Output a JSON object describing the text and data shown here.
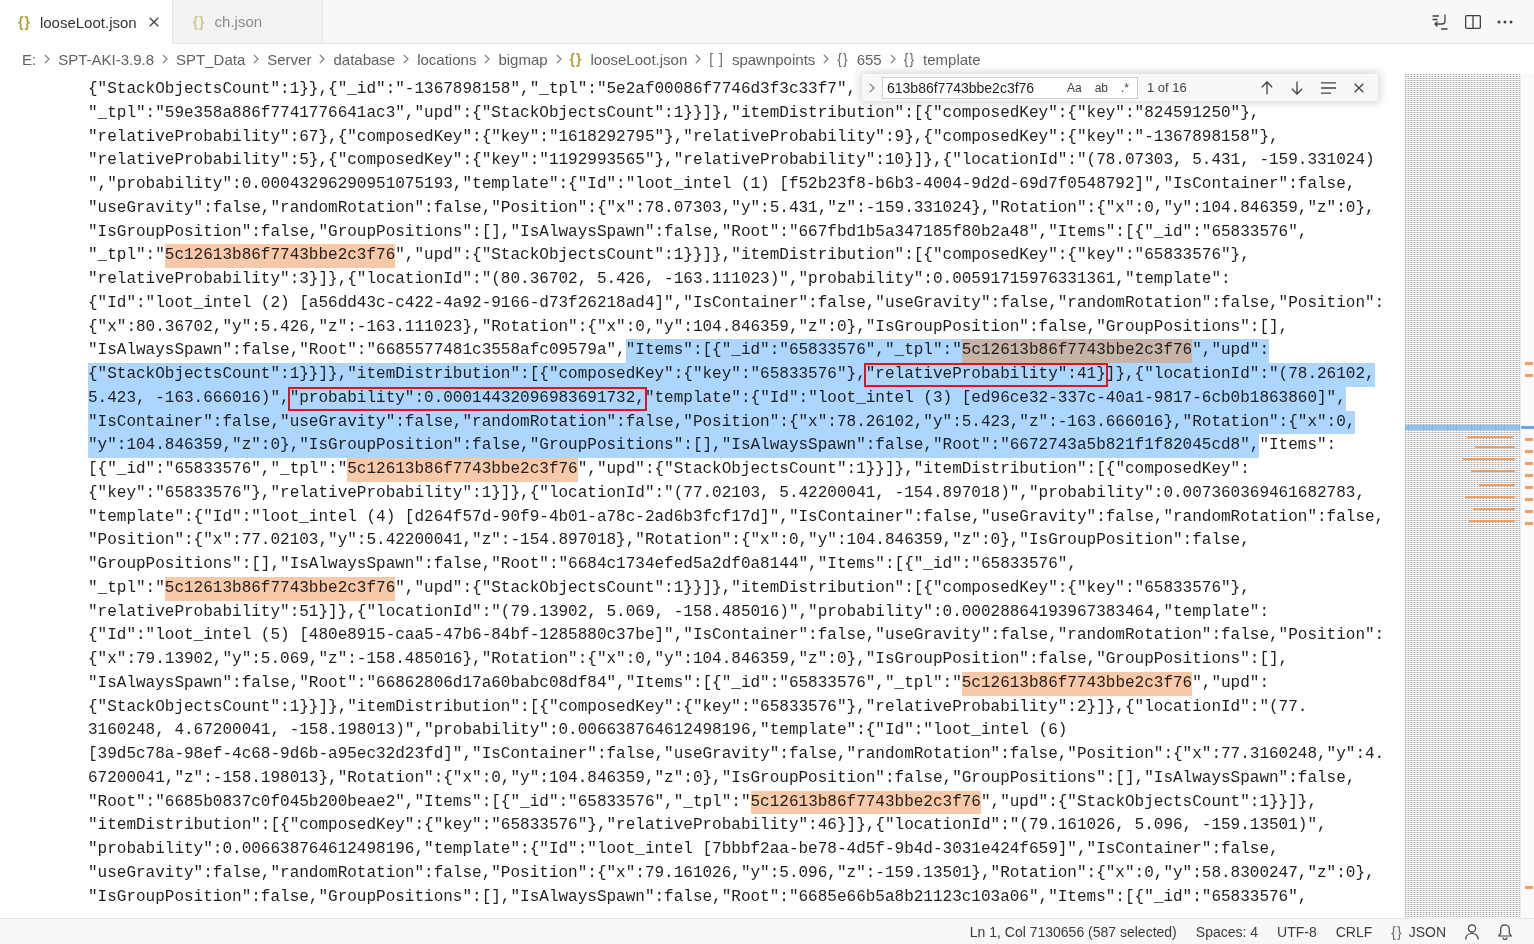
{
  "tabs": [
    {
      "symbol": "{}",
      "label": "looseLoot.json",
      "selected": true
    },
    {
      "symbol": "{}",
      "label": "ch.json",
      "selected": false
    }
  ],
  "breadcrumb": [
    {
      "kind": "folder",
      "label": "E:"
    },
    {
      "kind": "folder",
      "label": "SPT-AKI-3.9.8"
    },
    {
      "kind": "folder",
      "label": "SPT_Data"
    },
    {
      "kind": "folder",
      "label": "Server"
    },
    {
      "kind": "folder",
      "label": "database"
    },
    {
      "kind": "folder",
      "label": "locations"
    },
    {
      "kind": "folder",
      "label": "bigmap"
    },
    {
      "kind": "file",
      "symbol": "{}",
      "label": "looseLoot.json"
    },
    {
      "kind": "symbol",
      "symbol": "[ ]",
      "label": "spawnpoints"
    },
    {
      "kind": "symbol",
      "symbol": "{}",
      "label": "655"
    },
    {
      "kind": "symbol",
      "symbol": "{}",
      "label": "template"
    }
  ],
  "find_widget": {
    "value": "613b86f7743bbe2c3f76",
    "options": [
      {
        "label": "Aa",
        "on": false
      },
      {
        "label": "ab",
        "on": false
      },
      {
        "label": ".*",
        "on": false
      }
    ],
    "result": "1 of 16"
  },
  "editor": {
    "lines": [
      {
        "segments": [
          {
            "kind": "plain",
            "text": "{\"StackObjectsCount\":1}},{\"_id\":\"-1367898158\",\"_tpl\":\"5e2af00086f7746d3f3c33f7\","
          }
        ]
      },
      {
        "segments": [
          {
            "kind": "plain",
            "text": "\"_tpl\":\"59e358a886f7741776641ac3\",\"upd\":{\"StackObjectsCount\":1}}]},\"itemDistribution\":[{\"composedKey\":{\"key\":\"824591250\"},"
          }
        ]
      },
      {
        "segments": [
          {
            "kind": "plain",
            "text": "\"relativeProbability\":67},{\"composedKey\":{\"key\":\"1618292795\"},\"relativeProbability\":9},{\"composedKey\":{\"key\":\"-1367898158\"},"
          }
        ]
      },
      {
        "segments": [
          {
            "kind": "plain",
            "text": "\"relativeProbability\":5},{\"composedKey\":{\"key\":\"1192993565\"},\"relativeProbability\":10}]},{\"locationId\":\"(78.07303, 5.431, -159.331024)"
          }
        ]
      },
      {
        "segments": [
          {
            "kind": "plain",
            "text": "\",\"probability\":0.00043296290951075193,\"template\":{\"Id\":\"loot_intel (1) [f52b23f8-b6b3-4004-9d2d-69d7f0548792]\",\"IsContainer\":false,"
          }
        ]
      },
      {
        "segments": [
          {
            "kind": "plain",
            "text": "\"useGravity\":false,\"randomRotation\":false,\"Position\":{\"x\":78.07303,\"y\":5.431,\"z\":-159.331024},\"Rotation\":{\"x\":0,\"y\":104.846359,\"z\":0},"
          }
        ]
      },
      {
        "segments": [
          {
            "kind": "plain",
            "text": "\"IsGroupPosition\":false,\"GroupPositions\":[],\"IsAlwaysSpawn\":false,\"Root\":\"667fbd1b5a347185f80b2a48\",\"Items\":[{\"_id\":\"65833576\","
          }
        ]
      },
      {
        "segments": [
          {
            "kind": "plain",
            "text": "\"_tpl\":\""
          },
          {
            "kind": "match",
            "text": "5c12613b86f7743bbe2c3f76"
          },
          {
            "kind": "plain",
            "text": "\",\"upd\":{\"StackObjectsCount\":1}}]},\"itemDistribution\":[{\"composedKey\":{\"key\":\"65833576\"},"
          }
        ]
      },
      {
        "segments": [
          {
            "kind": "plain",
            "text": "\"relativeProbability\":3}]},{\"locationId\":\"(80.36702, 5.426, -163.111023)\",\"probability\":0.00591715976331361,\"template\":"
          }
        ]
      },
      {
        "segments": [
          {
            "kind": "plain",
            "text": "{\"Id\":\"loot_intel (2) [a56dd43c-c422-4a92-9166-d73f26218ad4]\",\"IsContainer\":false,\"useGravity\":false,\"randomRotation\":false,\"Position\":"
          }
        ]
      },
      {
        "segments": [
          {
            "kind": "plain",
            "text": "{\"x\":80.36702,\"y\":5.426,\"z\":-163.111023},\"Rotation\":{\"x\":0,\"y\":104.846359,\"z\":0},\"IsGroupPosition\":false,\"GroupPositions\":[],"
          }
        ]
      },
      {
        "segments": [
          {
            "kind": "plain",
            "text": "\"IsAlwaysSpawn\":false,\"Root\":\"6685577481c3558afc09579a\","
          },
          {
            "kind": "selected",
            "text": "\"Items\":[{\"_id\":\"65833576\",\"_tpl\":\""
          },
          {
            "kind": "current",
            "text": "5c12613b86f7743bbe2c3f76"
          },
          {
            "kind": "selected",
            "text": "\",\"upd\":"
          }
        ]
      },
      {
        "segments": [
          {
            "kind": "selected",
            "text": "{\"StackObjectsCount\":1}}]},\"itemDistribution\":[{\"composedKey\":{\"key\":\"65833576\"},"
          },
          {
            "kind": "boxed",
            "text": "\"relativeProbability\":41}"
          },
          {
            "kind": "selected",
            "text": "]},{\"locationId\":\"(78.26102,"
          }
        ]
      },
      {
        "segments": [
          {
            "kind": "selected",
            "text": "5.423, -163.666016)\","
          },
          {
            "kind": "boxed",
            "text": "\"probability\":0.00014432096983691732,"
          },
          {
            "kind": "selected",
            "text": "\"template\":{\"Id\":\"loot_intel (3) [ed96ce32-337c-40a1-9817-6cb0b1863860]\","
          }
        ]
      },
      {
        "segments": [
          {
            "kind": "selected",
            "text": "\"IsContainer\":false,\"useGravity\":false,\"randomRotation\":false,\"Position\":{\"x\":78.26102,\"y\":5.423,\"z\":-163.666016},\"Rotation\":{\"x\":0,"
          }
        ]
      },
      {
        "segments": [
          {
            "kind": "selected",
            "text": "\"y\":104.846359,\"z\":0},\"IsGroupPosition\":false,\"GroupPositions\":[],\"IsAlwaysSpawn\":false,\"Root\":\"6672743a5b821f1f82045cd8\","
          },
          {
            "kind": "plain",
            "text": "\"Items\":"
          }
        ]
      },
      {
        "segments": [
          {
            "kind": "plain",
            "text": "[{\"_id\":\"65833576\",\"_tpl\":\""
          },
          {
            "kind": "match",
            "text": "5c12613b86f7743bbe2c3f76"
          },
          {
            "kind": "plain",
            "text": "\",\"upd\":{\"StackObjectsCount\":1}}]},\"itemDistribution\":[{\"composedKey\":"
          }
        ]
      },
      {
        "segments": [
          {
            "kind": "plain",
            "text": "{\"key\":\"65833576\"},\"relativeProbability\":1}]},{\"locationId\":\"(77.02103, 5.42200041, -154.897018)\",\"probability\":0.007360369461682783,"
          }
        ]
      },
      {
        "segments": [
          {
            "kind": "plain",
            "text": "\"template\":{\"Id\":\"loot_intel (4) [d264f57d-90f9-4b01-a78c-2ad6b3fcf17d]\",\"IsContainer\":false,\"useGravity\":false,\"randomRotation\":false,"
          }
        ]
      },
      {
        "segments": [
          {
            "kind": "plain",
            "text": "\"Position\":{\"x\":77.02103,\"y\":5.42200041,\"z\":-154.897018},\"Rotation\":{\"x\":0,\"y\":104.846359,\"z\":0},\"IsGroupPosition\":false,"
          }
        ]
      },
      {
        "segments": [
          {
            "kind": "plain",
            "text": "\"GroupPositions\":[],\"IsAlwaysSpawn\":false,\"Root\":\"6684c1734efed5a2df0a8144\",\"Items\":[{\"_id\":\"65833576\","
          }
        ]
      },
      {
        "segments": [
          {
            "kind": "plain",
            "text": "\"_tpl\":\""
          },
          {
            "kind": "match",
            "text": "5c12613b86f7743bbe2c3f76"
          },
          {
            "kind": "plain",
            "text": "\",\"upd\":{\"StackObjectsCount\":1}}]},\"itemDistribution\":[{\"composedKey\":{\"key\":\"65833576\"},"
          }
        ]
      },
      {
        "segments": [
          {
            "kind": "plain",
            "text": "\"relativeProbability\":51}]},{\"locationId\":\"(79.13902, 5.069, -158.485016)\",\"probability\":0.00028864193967383464,\"template\":"
          }
        ]
      },
      {
        "segments": [
          {
            "kind": "plain",
            "text": "{\"Id\":\"loot_intel (5) [480e8915-caa5-47b6-84bf-1285880c37be]\",\"IsContainer\":false,\"useGravity\":false,\"randomRotation\":false,\"Position\":"
          }
        ]
      },
      {
        "segments": [
          {
            "kind": "plain",
            "text": "{\"x\":79.13902,\"y\":5.069,\"z\":-158.485016},\"Rotation\":{\"x\":0,\"y\":104.846359,\"z\":0},\"IsGroupPosition\":false,\"GroupPositions\":[],"
          }
        ]
      },
      {
        "segments": [
          {
            "kind": "plain",
            "text": "\"IsAlwaysSpawn\":false,\"Root\":\"66862806d17a60babc08df84\",\"Items\":[{\"_id\":\"65833576\",\"_tpl\":\""
          },
          {
            "kind": "match",
            "text": "5c12613b86f7743bbe2c3f76"
          },
          {
            "kind": "plain",
            "text": "\",\"upd\":"
          }
        ]
      },
      {
        "segments": [
          {
            "kind": "plain",
            "text": "{\"StackObjectsCount\":1}}]},\"itemDistribution\":[{\"composedKey\":{\"key\":\"65833576\"},\"relativeProbability\":2}]},{\"locationId\":\"(77."
          }
        ]
      },
      {
        "segments": [
          {
            "kind": "plain",
            "text": "3160248, 4.67200041, -158.198013)\",\"probability\":0.006638764612498196,\"template\":{\"Id\":\"loot_intel (6)"
          }
        ]
      },
      {
        "segments": [
          {
            "kind": "plain",
            "text": "[39d5c78a-98ef-4c68-9d6b-a95ec32d23fd]\",\"IsContainer\":false,\"useGravity\":false,\"randomRotation\":false,\"Position\":{\"x\":77.3160248,\"y\":4."
          }
        ]
      },
      {
        "segments": [
          {
            "kind": "plain",
            "text": "67200041,\"z\":-158.198013},\"Rotation\":{\"x\":0,\"y\":104.846359,\"z\":0},\"IsGroupPosition\":false,\"GroupPositions\":[],\"IsAlwaysSpawn\":false,"
          }
        ]
      },
      {
        "segments": [
          {
            "kind": "plain",
            "text": "\"Root\":\"6685b0837c0f045b200beae2\",\"Items\":[{\"_id\":\"65833576\",\"_tpl\":\""
          },
          {
            "kind": "match",
            "text": "5c12613b86f7743bbe2c3f76"
          },
          {
            "kind": "plain",
            "text": "\",\"upd\":{\"StackObjectsCount\":1}}]},"
          }
        ]
      },
      {
        "segments": [
          {
            "kind": "plain",
            "text": "\"itemDistribution\":[{\"composedKey\":{\"key\":\"65833576\"},\"relativeProbability\":46}]},{\"locationId\":\"(79.161026, 5.096, -159.13501)\","
          }
        ]
      },
      {
        "segments": [
          {
            "kind": "plain",
            "text": "\"probability\":0.006638764612498196,\"template\":{\"Id\":\"loot_intel [7bbbf2aa-be78-4d5f-9b4d-3031e424f659]\",\"IsContainer\":false,"
          }
        ]
      },
      {
        "segments": [
          {
            "kind": "plain",
            "text": "\"useGravity\":false,\"randomRotation\":false,\"Position\":{\"x\":79.161026,\"y\":5.096,\"z\":-159.13501},\"Rotation\":{\"x\":0,\"y\":58.8300247,\"z\":0},"
          }
        ]
      },
      {
        "segments": [
          {
            "kind": "plain",
            "text": "\"IsGroupPosition\":false,\"GroupPositions\":[],\"IsAlwaysSpawn\":false,\"Root\":\"6685e66b5a8b21123c103a06\",\"Items\":[{\"_id\":\"65833576\","
          }
        ]
      }
    ]
  },
  "status_bar": [
    {
      "label": "Ln 1, Col 7130656 (587 selected)"
    },
    {
      "label": "Spaces: 4"
    },
    {
      "label": "UTF-8"
    },
    {
      "label": "CRLF"
    },
    {
      "symbol": "{}",
      "label": "JSON"
    }
  ]
}
